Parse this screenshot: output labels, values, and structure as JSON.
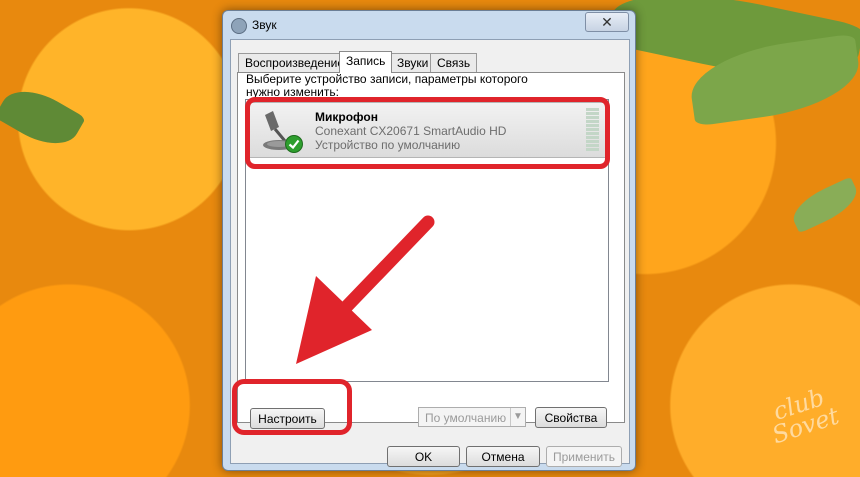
{
  "window": {
    "title": "Звук",
    "close_glyph": "✕"
  },
  "tabs": [
    {
      "label": "Воспроизведение",
      "active": false
    },
    {
      "label": "Запись",
      "active": true
    },
    {
      "label": "Звуки",
      "active": false
    },
    {
      "label": "Связь",
      "active": false
    }
  ],
  "panel": {
    "instruction": "Выберите устройство записи, параметры которого нужно изменить:"
  },
  "device": {
    "name": "Микрофон",
    "driver": "Conexant CX20671 SmartAudio HD",
    "status": "Устройство по умолчанию",
    "icon": "microphone-icon",
    "default_badge_icon": "check-badge-icon"
  },
  "buttons": {
    "configure": "Настроить",
    "set_default": "По умолчанию",
    "properties": "Свойства",
    "ok": "OK",
    "cancel": "Отмена",
    "apply": "Применить"
  },
  "watermark": {
    "line1": "club",
    "line2": "Sovet"
  },
  "colors": {
    "highlight": "#e0242b",
    "arrow": "#e0242b"
  }
}
